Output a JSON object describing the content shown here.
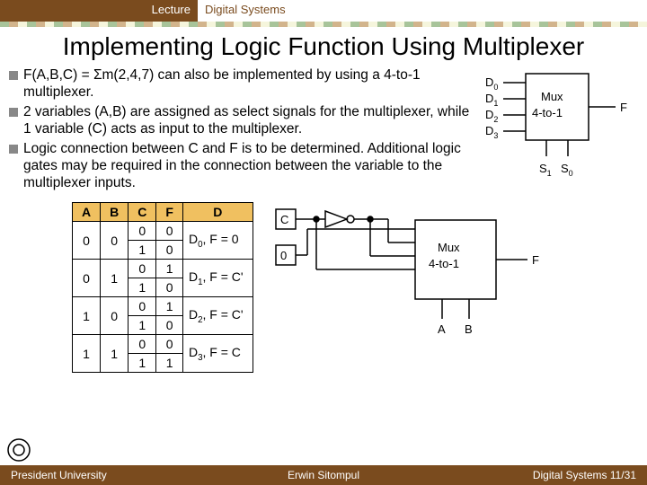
{
  "header": {
    "lecture": "Lecture",
    "topic": "Digital Systems"
  },
  "title": "Implementing Logic Function Using Multiplexer",
  "bullets": [
    "F(A,B,C) = Σm(2,4,7) can also be implemented by using a 4-to-1 multiplexer.",
    "2 variables (A,B) are assigned as select signals for the multiplexer, while 1 variable (C) acts as input to the multiplexer.",
    "Logic connection between C and F is to be determined. Additional logic gates may be required in the connection between the variable to the multiplexer inputs."
  ],
  "mux1": {
    "label_line1": "Mux",
    "label_line2": "4-to-1",
    "inputs": [
      "D",
      "D",
      "D",
      "D"
    ],
    "input_subs": [
      "0",
      "1",
      "2",
      "3"
    ],
    "output": "F",
    "selects": [
      "S",
      "S"
    ],
    "select_subs": [
      "1",
      "0"
    ]
  },
  "table": {
    "headers": [
      "A",
      "B",
      "C",
      "F",
      "D"
    ],
    "rows": [
      {
        "A": "0",
        "B": "0",
        "C": "0",
        "F": "0",
        "D": "D0, F = 0"
      },
      {
        "A": "",
        "B": "",
        "C": "1",
        "F": "0",
        "D": ""
      },
      {
        "A": "0",
        "B": "1",
        "C": "0",
        "F": "1",
        "D": "D1, F = C'"
      },
      {
        "A": "",
        "B": "",
        "C": "1",
        "F": "0",
        "D": ""
      },
      {
        "A": "1",
        "B": "0",
        "C": "0",
        "F": "1",
        "D": "D2, F = C'"
      },
      {
        "A": "",
        "B": "",
        "C": "1",
        "F": "0",
        "D": ""
      },
      {
        "A": "1",
        "B": "1",
        "C": "0",
        "F": "0",
        "D": "D3, F = C"
      },
      {
        "A": "",
        "B": "",
        "C": "1",
        "F": "1",
        "D": ""
      }
    ]
  },
  "diagram": {
    "C_label": "C",
    "zero_label": "0",
    "mux_line1": "Mux",
    "mux_line2": "4-to-1",
    "out_label": "F",
    "sel_A": "A",
    "sel_B": "B"
  },
  "footer": {
    "left": "President University",
    "center": "Erwin Sitompul",
    "right": "Digital Systems 11/31"
  }
}
